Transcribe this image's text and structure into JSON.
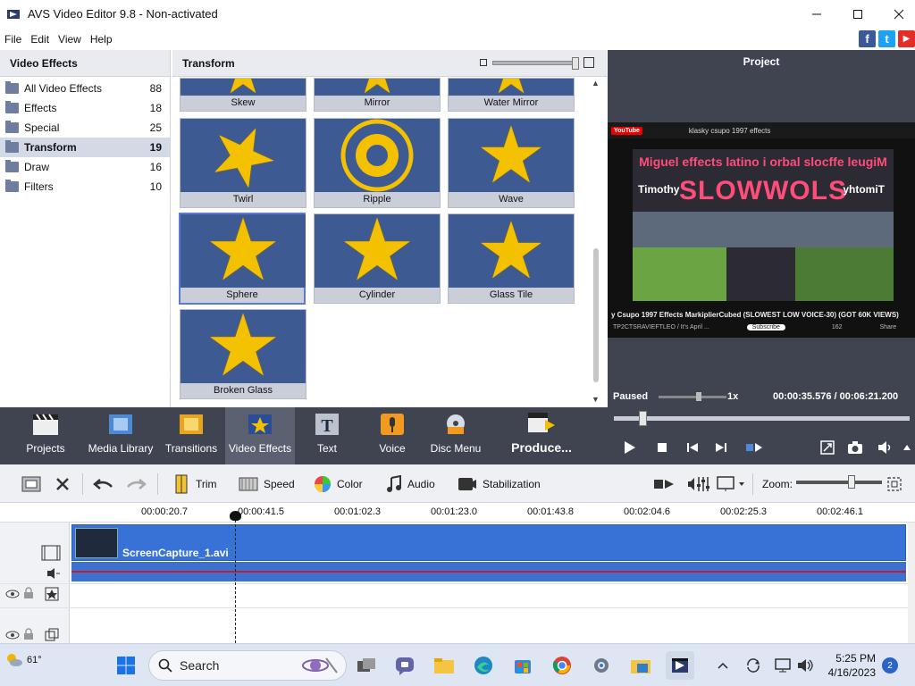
{
  "window": {
    "title": "AVS Video Editor 9.8 - Non-activated",
    "minimize": "—",
    "maximize": "☐",
    "close": "✕"
  },
  "menu": [
    "File",
    "Edit",
    "View",
    "Help"
  ],
  "social": {
    "facebook": "f",
    "twitter": "t",
    "youtube": "▶",
    "colors": {
      "facebook": "#3b5998",
      "twitter": "#1da1f2",
      "youtube": "#e52d27"
    }
  },
  "left_panel": {
    "title": "Video Effects",
    "categories": [
      {
        "name": "All Video Effects",
        "count": "88"
      },
      {
        "name": "Effects",
        "count": "18"
      },
      {
        "name": "Special",
        "count": "25"
      },
      {
        "name": "Transform",
        "count": "19"
      },
      {
        "name": "Draw",
        "count": "16"
      },
      {
        "name": "Filters",
        "count": "10"
      }
    ],
    "selected": "Transform"
  },
  "effects_panel": {
    "title": "Transform",
    "tiles": [
      {
        "label": "Skew"
      },
      {
        "label": "Mirror"
      },
      {
        "label": "Water Mirror"
      },
      {
        "label": "Twirl"
      },
      {
        "label": "Ripple"
      },
      {
        "label": "Wave"
      },
      {
        "label": "Sphere"
      },
      {
        "label": "Cylinder"
      },
      {
        "label": "Glass Tile"
      },
      {
        "label": "Broken Glass"
      }
    ],
    "selected": "Sphere"
  },
  "project_panel": {
    "title": "Project",
    "preview": {
      "yt_logo": "YouTube",
      "search_text": "klasky csupo 1997 effects",
      "caption_top": "Miguel effects latino i orbal slocffe leugiM",
      "caption_big": "SLOWWOLS",
      "caption_name": "Timothy",
      "caption_name_mirror": "yhtomiT",
      "video_title": "y Csupo 1997 Effects MarkiplierCubed (SLOWEST LOW VOICE-30) (GOT 60K VIEWS)",
      "channel": "TP2CTSRAVIEFTLEO / It's April ...",
      "subscribe": "Subscribe",
      "likes": "162",
      "share": "Share"
    },
    "status": "Paused",
    "speed": "1x",
    "time_current": "00:00:35.576",
    "time_sep": "/",
    "time_total": "00:06:21.200"
  },
  "toolbar": {
    "items": [
      {
        "label": "Projects"
      },
      {
        "label": "Media Library"
      },
      {
        "label": "Transitions"
      },
      {
        "label": "Video Effects"
      },
      {
        "label": "Text"
      },
      {
        "label": "Voice"
      },
      {
        "label": "Disc Menu"
      },
      {
        "label": "Produce..."
      }
    ],
    "active": "Video Effects"
  },
  "edit_toolbar": {
    "trim": "Trim",
    "speed": "Speed",
    "color": "Color",
    "audio": "Audio",
    "stabilization": "Stabilization",
    "zoom": "Zoom:"
  },
  "timeline": {
    "ruler": [
      "00:00:20.7",
      "00:00:41.5",
      "00:01:02.3",
      "00:01:23.0",
      "00:01:43.8",
      "00:02:04.6",
      "00:02:25.3",
      "00:02:46.1"
    ],
    "clip": "ScreenCapture_1.avi"
  },
  "taskbar": {
    "weather": "61°",
    "search": "Search",
    "time": "5:25 PM",
    "date": "4/16/2023",
    "notifications": "2"
  }
}
